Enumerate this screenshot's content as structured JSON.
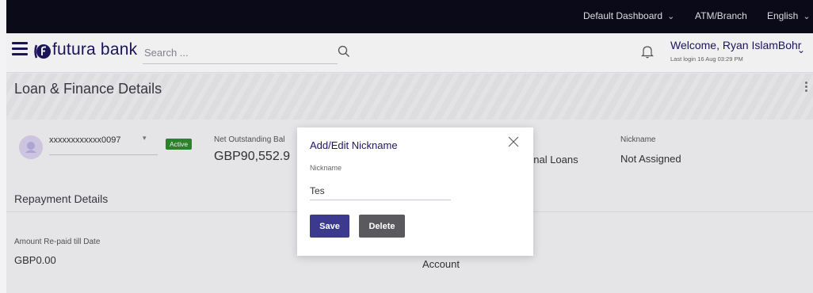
{
  "topbar": {
    "dashboard_label": "Default Dashboard",
    "atm_label": "ATM/Branch",
    "language_label": "English"
  },
  "header": {
    "brand_name": "futura bank",
    "search_placeholder": "Search ...",
    "welcome_text": "Welcome, Ryan IslamBohr",
    "last_login": "Last login 16 Aug 03:29 PM"
  },
  "page": {
    "title": "Loan & Finance Details"
  },
  "account": {
    "number": "xxxxxxxxxxxx0097",
    "status": "Active",
    "net_outstanding_label": "Net Outstanding Bal",
    "net_outstanding_value": "GBP90,552.9",
    "product_value_partial": "onal Loans",
    "nickname_label": "Nickname",
    "nickname_value": "Not Assigned"
  },
  "repayment": {
    "section_title": "Repayment Details",
    "amount_repaid_label": "Amount Re-paid till Date",
    "amount_repaid_value": "GBP0.00",
    "account_value_partial": "Account"
  },
  "modal": {
    "title": "Add/Edit Nickname",
    "field_label": "Nickname",
    "field_value": "Tes",
    "save_label": "Save",
    "delete_label": "Delete"
  },
  "colors": {
    "brand": "#1d1660",
    "topbar_bg": "#0b0b1a",
    "active_badge": "#2e8b2e",
    "save_button": "#3c3a8f",
    "delete_button": "#5a5a5e"
  }
}
